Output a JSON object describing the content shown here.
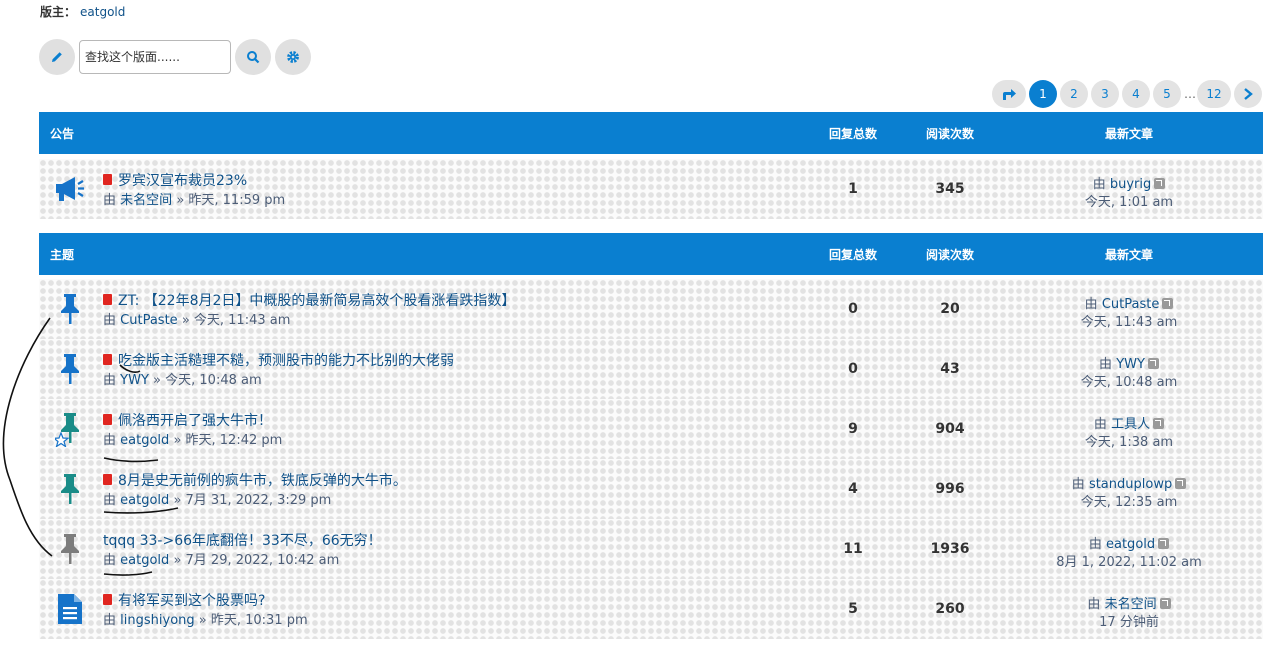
{
  "moderator": {
    "label": "版主：",
    "name": "eatgold"
  },
  "search": {
    "placeholder": "查找这个版面......"
  },
  "pagination": {
    "pages": [
      "1",
      "2",
      "3",
      "4",
      "5",
      "12"
    ],
    "ellipsis": "…",
    "current": "1"
  },
  "columns": {
    "replies": "回复总数",
    "views": "阅读次数",
    "last_post": "最新文章"
  },
  "announcements": {
    "title": "公告",
    "rows": [
      {
        "icon": "megaphone-icon",
        "title": "罗宾汉宣布裁员23%",
        "by": "由",
        "author": "未名空间",
        "date": "» 昨天, 11:59 pm",
        "replies": "1",
        "views": "345",
        "last_author": "buyrig",
        "last_time": "今天, 1:01 am"
      }
    ]
  },
  "topics": {
    "title": "主题",
    "rows": [
      {
        "icon": "pin-blue-icon",
        "title": "ZT: 【22年8月2日】中概股的最新简易高效个股看涨看跌指数】",
        "by": "由",
        "author": "CutPaste",
        "date": "» 今天, 11:43 am",
        "replies": "0",
        "views": "20",
        "last_author": "CutPaste",
        "last_time": "今天, 11:43 am"
      },
      {
        "icon": "pin-blue-icon",
        "title": "吃金版主活糙理不糙，预测股市的能力不比别的大佬弱",
        "by": "由",
        "author": "YWY",
        "date": "» 今天, 10:48 am",
        "replies": "0",
        "views": "43",
        "last_author": "YWY",
        "last_time": "今天, 10:48 am"
      },
      {
        "icon": "pin-teal-star-icon",
        "title": "佩洛西开启了强大牛市！",
        "by": "由",
        "author": "eatgold",
        "date": "» 昨天, 12:42 pm",
        "replies": "9",
        "views": "904",
        "last_author": "工具人",
        "last_time": "今天, 1:38 am"
      },
      {
        "icon": "pin-teal-icon",
        "title": "8月是史无前例的疯牛市，铁底反弹的大牛市。",
        "by": "由",
        "author": "eatgold",
        "date": "» 7月 31, 2022, 3:29 pm",
        "replies": "4",
        "views": "996",
        "last_author": "standuplowp",
        "last_time": "今天, 12:35 am"
      },
      {
        "icon": "pin-gray-icon",
        "title": "tqqq 33->66年底翻倍！33不尽，66无穷！",
        "by": "由",
        "author": "eatgold",
        "date": "» 7月 29, 2022, 10:42 am",
        "replies": "11",
        "views": "1936",
        "last_author": "eatgold",
        "last_time": "8月 1, 2022, 11:02 am"
      },
      {
        "icon": "document-icon",
        "title": "有将军买到这个股票吗?",
        "by": "由",
        "author": "lingshiyong",
        "date": "» 昨天, 10:31 pm",
        "replies": "5",
        "views": "260",
        "last_author": "未名空间",
        "last_time": "17 分钟前"
      }
    ]
  },
  "colors": {
    "accent": "#0a7fd0",
    "pin_blue": "#1673c9",
    "pin_teal": "#1a8c88",
    "pin_gray": "#7d7d7d",
    "pdf_red": "#e0251f",
    "link": "#105289"
  }
}
